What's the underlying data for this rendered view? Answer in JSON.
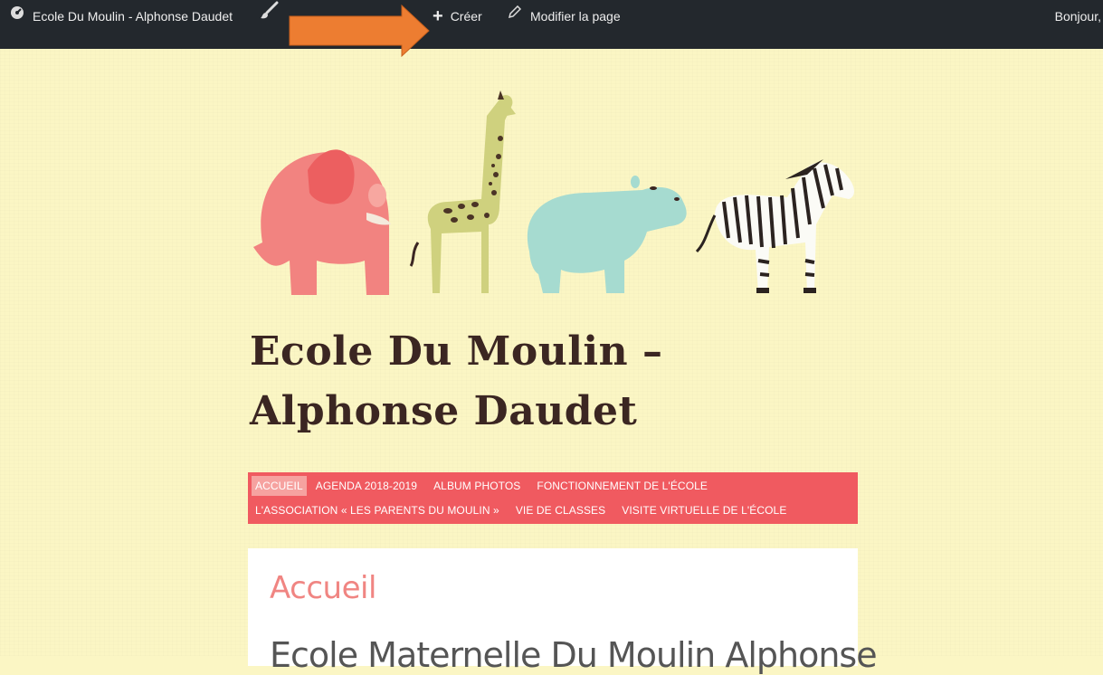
{
  "admin_bar": {
    "site_name": "Ecole Du Moulin - Alphonse Daudet",
    "new_label": "Créer",
    "edit_label": "Modifier la page",
    "greeting": "Bonjour,"
  },
  "site": {
    "title": "Ecole Du Moulin – Alphonse Daudet"
  },
  "nav": {
    "row1": [
      "Accueil",
      "Agenda 2018-2019",
      "Album photos",
      "Fonctionnement de l'école"
    ],
    "row2": [
      "L'association « Les parents du Moulin »",
      "Vie de classes",
      "Visite virtuelle de l'école"
    ],
    "active": "Accueil"
  },
  "content": {
    "heading": "Accueil",
    "subtitle": "Ecole Maternelle Du Moulin Alphonse"
  },
  "colors": {
    "admin_bar": "#23282d",
    "page_bg": "#fbf6c4",
    "nav_bg": "#f05a60",
    "nav_active": "#f6a2a0",
    "title": "#3b2622",
    "heading": "#f08582",
    "arrow": "#ed7d31"
  }
}
